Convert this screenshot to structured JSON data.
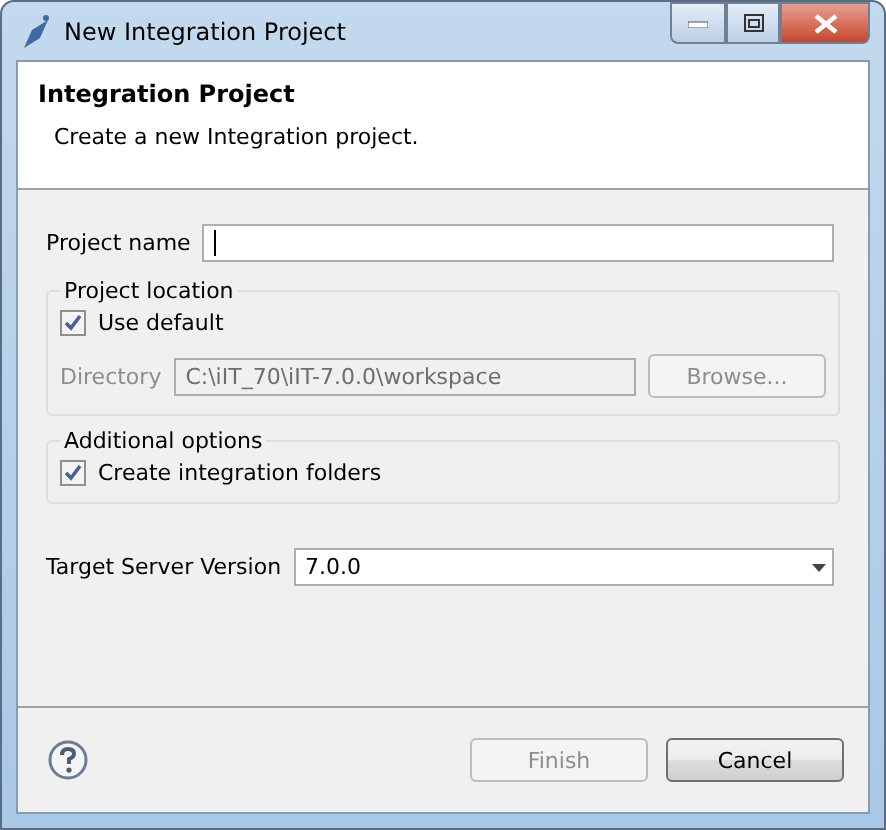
{
  "window": {
    "title": "New Integration Project"
  },
  "header": {
    "title": "Integration Project",
    "description": "Create a new Integration project."
  },
  "project_name": {
    "label": "Project name"
  },
  "project_location": {
    "legend": "Project location",
    "use_default": {
      "label": "Use default",
      "checked": true
    },
    "directory": {
      "label": "Directory",
      "value": "C:\\iIT_70\\iIT-7.0.0\\workspace",
      "disabled": true
    },
    "browse": {
      "label": "Browse...",
      "disabled": true
    }
  },
  "additional_options": {
    "legend": "Additional options",
    "create_folders": {
      "label": "Create integration folders",
      "checked": true
    }
  },
  "target_server": {
    "label": "Target Server Version",
    "value": "7.0.0"
  },
  "buttons": [
    {
      "label": "Finish",
      "disabled": true
    },
    {
      "label": "Cancel",
      "disabled": false
    }
  ]
}
